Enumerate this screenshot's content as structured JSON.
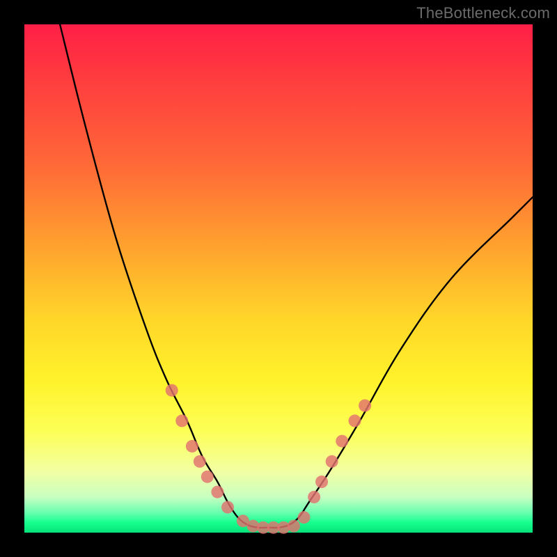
{
  "watermark": "TheBottleneck.com",
  "chart_data": {
    "type": "line",
    "title": "",
    "xlabel": "",
    "ylabel": "",
    "xlim": [
      0,
      100
    ],
    "ylim": [
      0,
      100
    ],
    "grid": false,
    "legend": false,
    "series": [
      {
        "name": "bottleneck-curve",
        "color": "#000000",
        "x": [
          7,
          12,
          18,
          24,
          28,
          32,
          35,
          38,
          40,
          42,
          44,
          46,
          48,
          50,
          52,
          54,
          56,
          60,
          66,
          74,
          84,
          96,
          100
        ],
        "y": [
          100,
          80,
          58,
          40,
          30,
          22,
          15,
          10,
          6,
          3,
          1.5,
          1,
          1,
          1,
          1.5,
          3,
          6,
          12,
          22,
          36,
          50,
          62,
          66
        ]
      }
    ],
    "markers": {
      "name": "highlight-dots",
      "color": "#e2716f",
      "radius_px": 9,
      "points": [
        {
          "x": 29,
          "y": 28
        },
        {
          "x": 31,
          "y": 22
        },
        {
          "x": 33,
          "y": 17
        },
        {
          "x": 34.5,
          "y": 14
        },
        {
          "x": 36,
          "y": 11
        },
        {
          "x": 38,
          "y": 8
        },
        {
          "x": 40,
          "y": 5
        },
        {
          "x": 43,
          "y": 2.3
        },
        {
          "x": 45,
          "y": 1.3
        },
        {
          "x": 47,
          "y": 1
        },
        {
          "x": 49,
          "y": 1
        },
        {
          "x": 51,
          "y": 1
        },
        {
          "x": 53,
          "y": 1.3
        },
        {
          "x": 55,
          "y": 3
        },
        {
          "x": 57,
          "y": 7
        },
        {
          "x": 58.5,
          "y": 10
        },
        {
          "x": 60.5,
          "y": 14
        },
        {
          "x": 62.5,
          "y": 18
        },
        {
          "x": 65,
          "y": 22
        },
        {
          "x": 67,
          "y": 25
        }
      ]
    }
  }
}
